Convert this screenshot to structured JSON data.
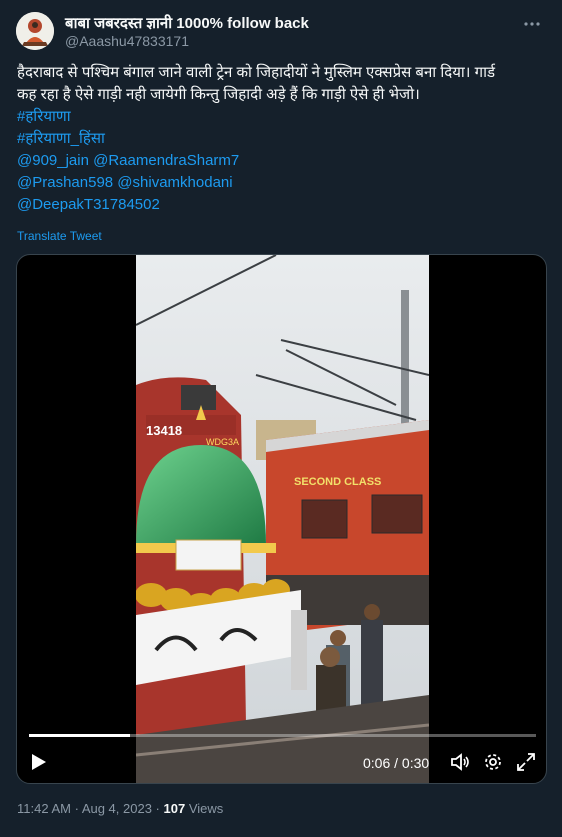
{
  "author": {
    "display_name": "बाबा जबरदस्त ज्ञानी 1000% follow back",
    "handle": "@Aaashu47833171"
  },
  "tweet": {
    "lines": [
      "हैदराबाद से पश्चिम बंगाल जाने वाली ट्रेन को जिहादीयों ने मुस्लिम एक्सप्रेस बना दिया। गार्ड",
      "कह रहा है ऐसे गाड़ी नही जायेगी किन्तु जिहादी अड़े हैं कि गाड़ी ऐसे ही भेजो।"
    ],
    "hashtags": [
      "#हरियाणा",
      "#हरियाणा_हिंसा"
    ],
    "mentions": {
      "m1": "@909_jain",
      "m2": "@RaamendraSharm7",
      "m3": "@Prashan598",
      "m4": "@shivamkhodani",
      "m5": "@DeepakT31784502"
    },
    "translate_label": "Translate Tweet"
  },
  "video": {
    "time_display": "0:06 / 0:30",
    "progress": 0.2,
    "locomotive_number": "13418",
    "locomotive_class": "WDG3A",
    "coach_label": "SECOND CLASS"
  },
  "footer": {
    "time": "11:42 AM",
    "separator": " · ",
    "date": "Aug 4, 2023",
    "views_count": "107",
    "views_label": " Views"
  },
  "icons": {
    "more": "more-icon",
    "play": "play-icon",
    "volume": "volume-icon",
    "settings": "gear-icon",
    "fullscreen": "fullscreen-icon"
  },
  "colors": {
    "background": "#15202b",
    "link": "#1d9bf0",
    "muted": "#8b98a5"
  }
}
